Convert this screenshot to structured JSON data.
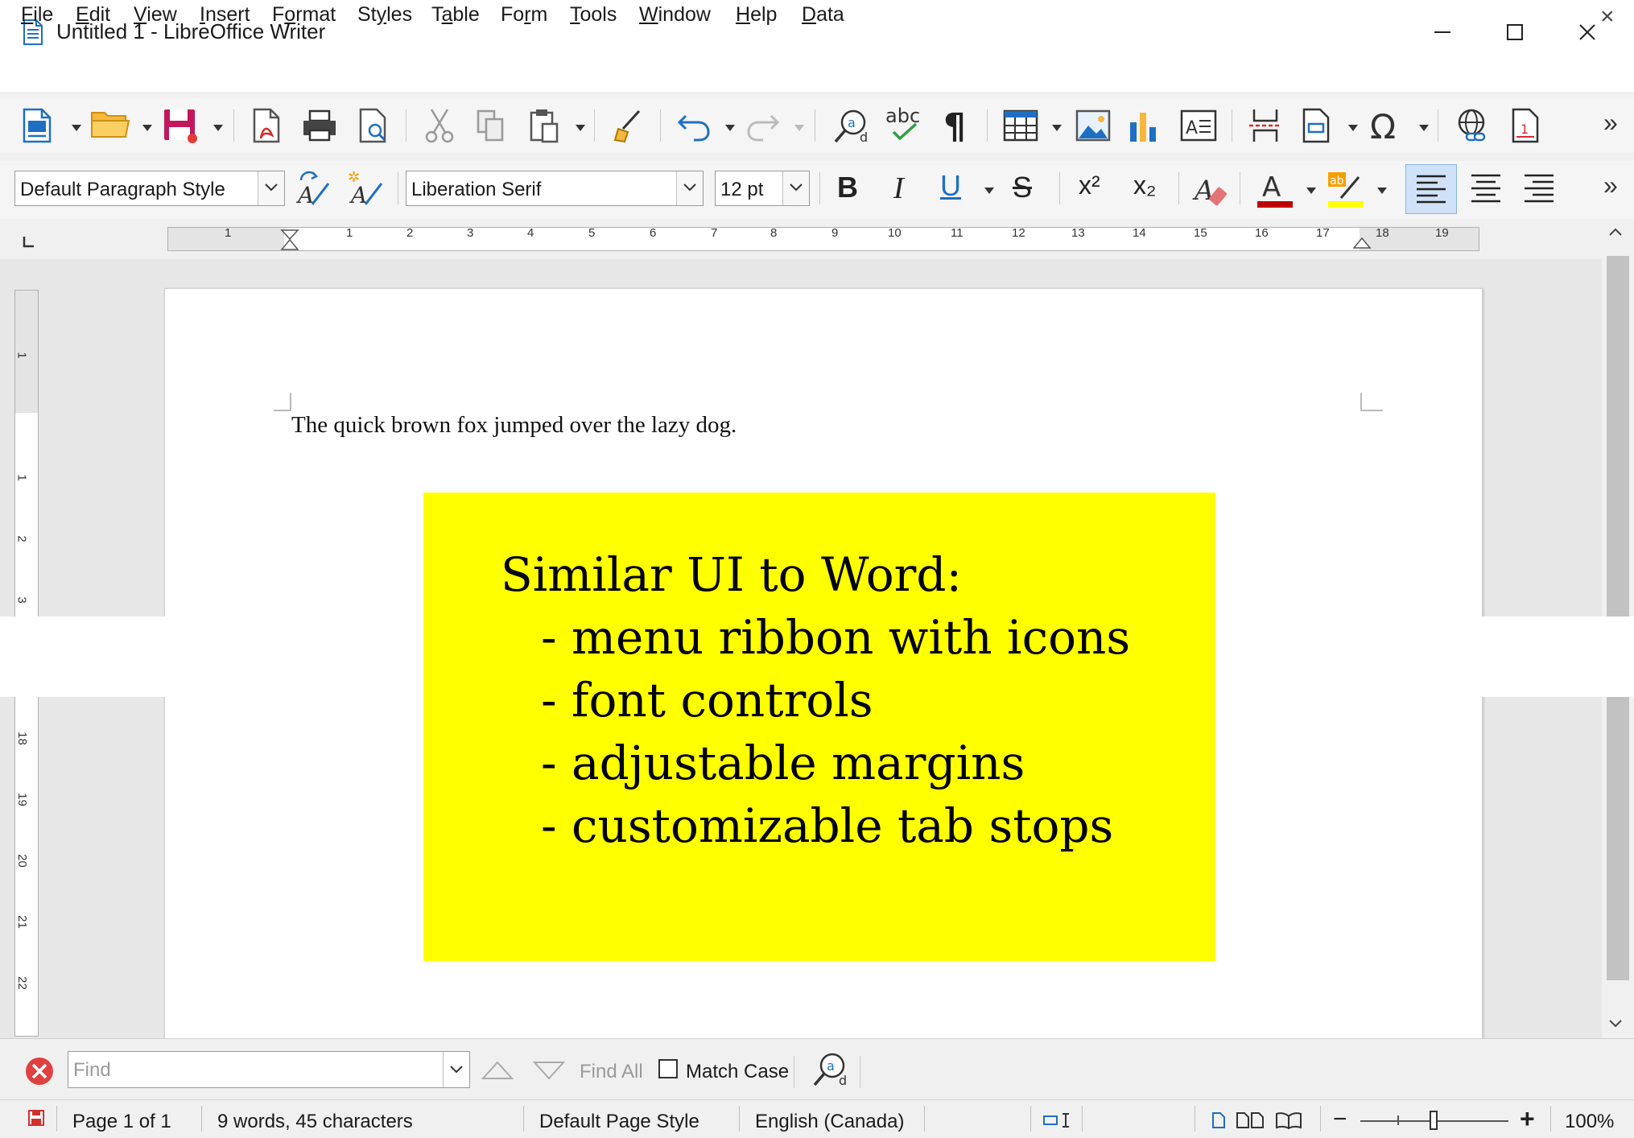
{
  "window": {
    "title": "Untitled 1 - LibreOffice Writer",
    "controls": [
      "minimize",
      "maximize",
      "close"
    ]
  },
  "menu": {
    "items": [
      {
        "label": "File",
        "mnemonic": "F"
      },
      {
        "label": "Edit",
        "mnemonic": "E"
      },
      {
        "label": "View",
        "mnemonic": "V"
      },
      {
        "label": "Insert",
        "mnemonic": "I"
      },
      {
        "label": "Format",
        "mnemonic": "o"
      },
      {
        "label": "Styles",
        "mnemonic": "y"
      },
      {
        "label": "Table",
        "mnemonic": "a"
      },
      {
        "label": "Form",
        "mnemonic": "r"
      },
      {
        "label": "Tools",
        "mnemonic": "T"
      },
      {
        "label": "Window",
        "mnemonic": "W"
      },
      {
        "label": "Help",
        "mnemonic": "H"
      },
      {
        "label": "Data",
        "mnemonic": "D"
      }
    ]
  },
  "standard_toolbar": {
    "icons": [
      "new-document-icon",
      "open-folder-icon",
      "save-icon",
      "export-pdf-icon",
      "print-icon",
      "print-preview-icon",
      "cut-icon",
      "copy-icon",
      "paste-icon",
      "clone-formatting-icon",
      "undo-icon",
      "redo-icon",
      "find-replace-icon",
      "spelling-icon",
      "formatting-marks-icon",
      "insert-table-icon",
      "insert-image-icon",
      "insert-chart-icon",
      "insert-textbox-icon",
      "page-break-icon",
      "insert-field-icon",
      "special-character-icon",
      "hyperlink-icon",
      "footnote-icon"
    ]
  },
  "formatting_toolbar": {
    "paragraph_style": "Default Paragraph Style",
    "font_name": "Liberation Serif",
    "font_size": "12 pt",
    "superscript": "x²",
    "subscript": "x₂"
  },
  "ruler": {
    "horizontal_numbers": [
      "1",
      "1",
      "2",
      "3",
      "4",
      "5",
      "6",
      "7",
      "8",
      "9",
      "10",
      "11",
      "12",
      "13",
      "14",
      "15",
      "16",
      "17",
      "18",
      "19"
    ],
    "vertical_numbers": [
      "1",
      "1",
      "2",
      "3",
      "18",
      "19",
      "20",
      "21",
      "22"
    ]
  },
  "document": {
    "body_text": "The quick brown fox jumped over the lazy dog."
  },
  "callout": {
    "heading": "Similar UI to Word:",
    "lines": [
      "- menu ribbon with icons",
      "- font controls",
      "- adjustable margins",
      "- customizable tab stops"
    ],
    "background": "#ffff00"
  },
  "find_toolbar": {
    "placeholder": "Find",
    "find_all": "Find All",
    "match_case": "Match Case"
  },
  "status_bar": {
    "page": "Page 1 of 1",
    "word_count": "9 words, 45 characters",
    "page_style": "Default Page Style",
    "language": "English (Canada)",
    "zoom": "100%"
  },
  "colors": {
    "accent_blue": "#1e6fc4",
    "font_color_red": "#c00000",
    "highlight_yellow": "#ffff00",
    "close_red": "#e04040"
  }
}
